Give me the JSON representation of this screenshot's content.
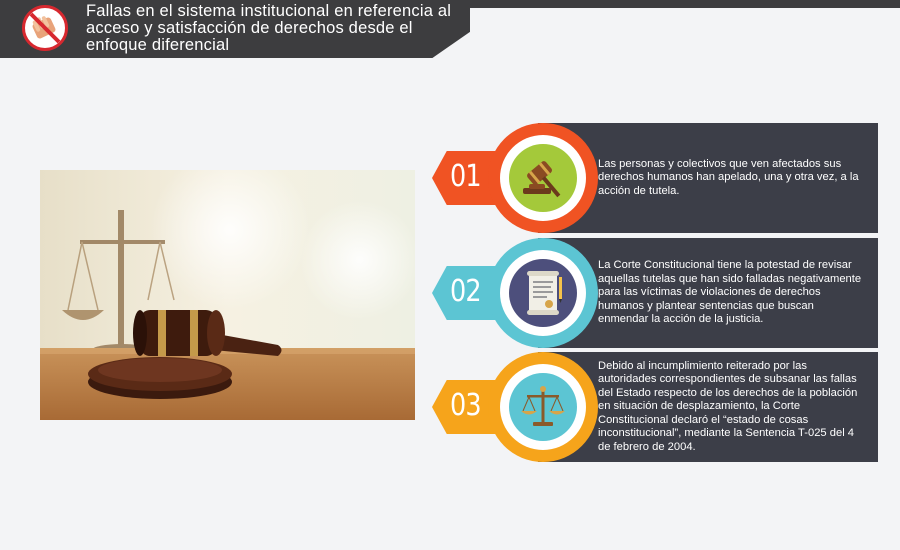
{
  "header": {
    "title": "Fallas en el sistema institucional en referencia al acceso y satisfacción de derechos desde el enfoque diferencial"
  },
  "items": [
    {
      "number": "01",
      "icon": "gavel-icon",
      "color": "#f05323",
      "text": "Las personas y colectivos que ven afectados sus derechos humanos han apelado, una y otra vez, a la acción de tutela."
    },
    {
      "number": "02",
      "icon": "document-icon",
      "color": "#5cc5d3",
      "text": "La Corte Constitucional tiene la potestad de revisar aquellas tutelas que han sido falladas negativamente para las víctimas de violaciones de derechos humanos y plantear sentencias que buscan enmendar la acción de la justicia."
    },
    {
      "number": "03",
      "icon": "scales-icon",
      "color": "#f6a41b",
      "text": "Debido al incumplimiento reiterado por las autoridades correspondientes de subsanar las fallas del Estado respecto de los derechos de la población en situación de desplazamiento, la Corte Constitucional declaró el “estado de cosas inconstitucional”, mediante la Sentencia T-025 del 4 de febrero de 2004."
    }
  ],
  "colors": {
    "header_bg": "#3d3d3f",
    "panel_bg": "#3c3e48",
    "page_bg": "#f3f4f6"
  }
}
